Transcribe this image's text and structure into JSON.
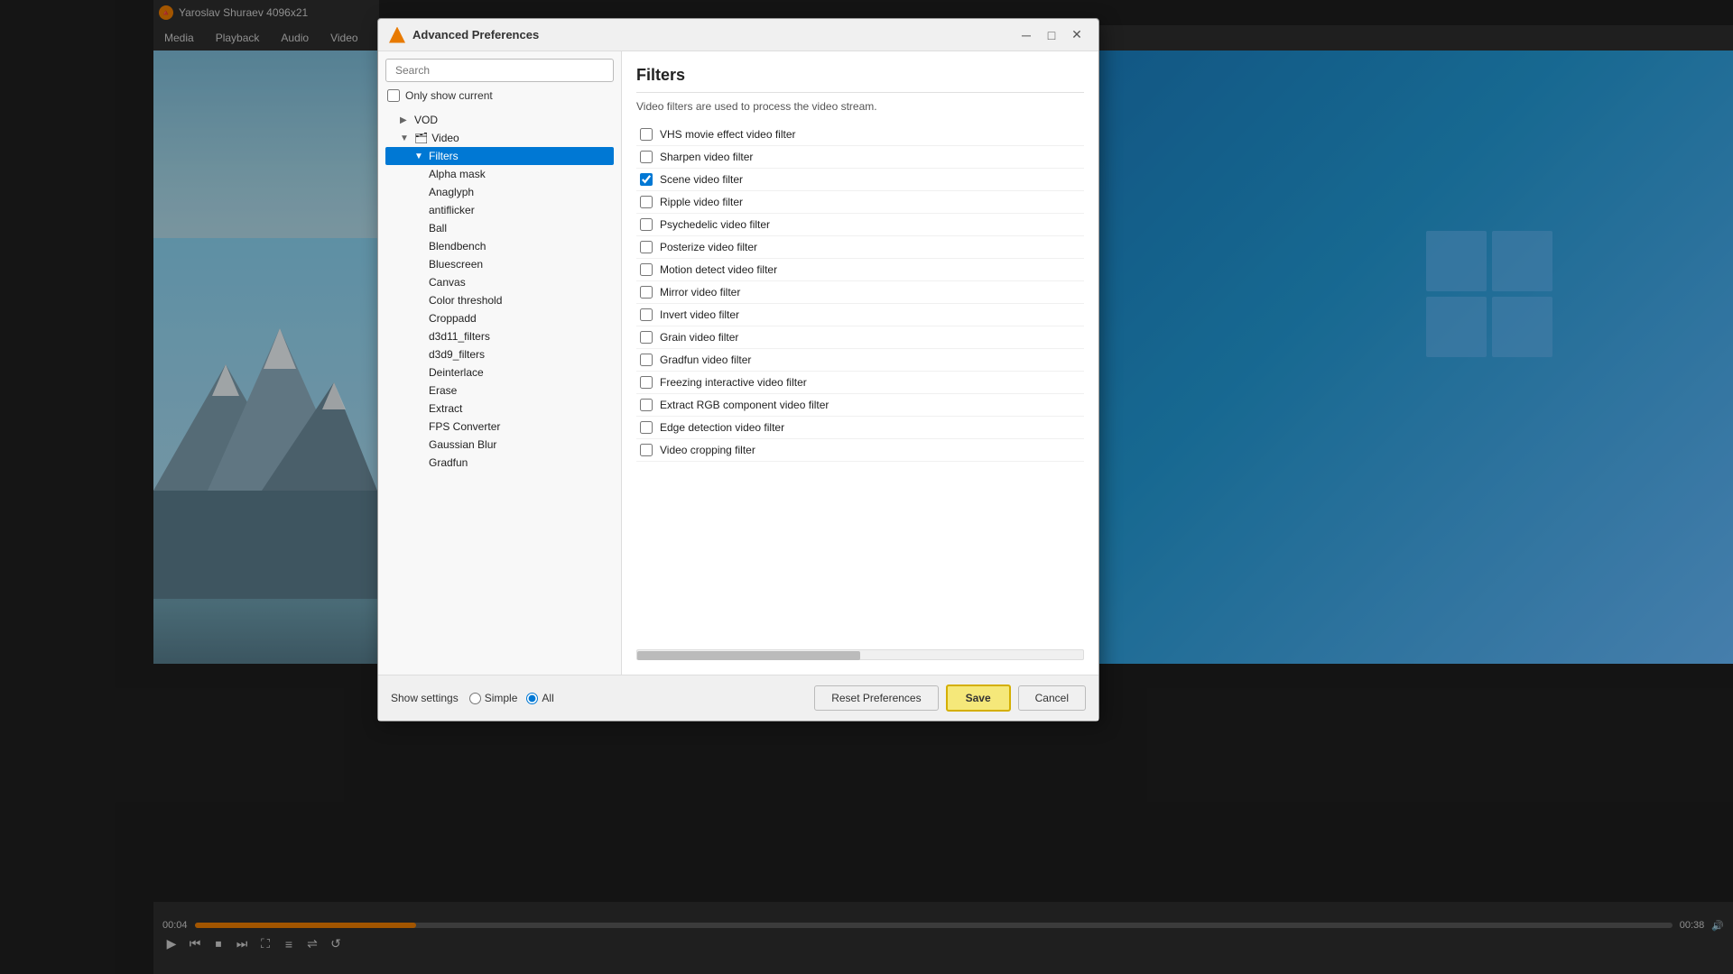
{
  "app": {
    "title": "Yaroslav Shuraev 4096x21",
    "vlc_icon": "▶",
    "menubar": {
      "items": [
        "Media",
        "Playback",
        "Audio",
        "Video"
      ]
    }
  },
  "dialog": {
    "title": "Advanced Preferences",
    "title_icon": "cone",
    "controls": {
      "minimize": "─",
      "maximize": "□",
      "close": "✕"
    }
  },
  "left_panel": {
    "search": {
      "placeholder": "Search",
      "value": ""
    },
    "only_show_current": {
      "label": "Only show current",
      "checked": false
    },
    "tree": {
      "items": [
        {
          "id": "vod",
          "label": "VOD",
          "indent": 1,
          "icon": "▶",
          "expanded": false
        },
        {
          "id": "video",
          "label": "Video",
          "indent": 1,
          "icon": "▼",
          "expanded": true,
          "folder": true
        },
        {
          "id": "filters",
          "label": "Filters",
          "indent": 2,
          "icon": "▼",
          "expanded": true,
          "selected": true
        },
        {
          "id": "alpha-mask",
          "label": "Alpha mask",
          "indent": 3
        },
        {
          "id": "anaglyph",
          "label": "Anaglyph",
          "indent": 3
        },
        {
          "id": "antiflicker",
          "label": "antiflicker",
          "indent": 3
        },
        {
          "id": "ball",
          "label": "Ball",
          "indent": 3
        },
        {
          "id": "blendbench",
          "label": "Blendbench",
          "indent": 3
        },
        {
          "id": "bluescreen",
          "label": "Bluescreen",
          "indent": 3
        },
        {
          "id": "canvas",
          "label": "Canvas",
          "indent": 3
        },
        {
          "id": "color-threshold",
          "label": "Color threshold",
          "indent": 3
        },
        {
          "id": "croppadd",
          "label": "Croppadd",
          "indent": 3
        },
        {
          "id": "d3d11-filters",
          "label": "d3d11_filters",
          "indent": 3
        },
        {
          "id": "d3d9-filters",
          "label": "d3d9_filters",
          "indent": 3
        },
        {
          "id": "deinterlace",
          "label": "Deinterlace",
          "indent": 3
        },
        {
          "id": "erase",
          "label": "Erase",
          "indent": 3
        },
        {
          "id": "extract",
          "label": "Extract",
          "indent": 3
        },
        {
          "id": "fps-converter",
          "label": "FPS Converter",
          "indent": 3
        },
        {
          "id": "gaussian-blur",
          "label": "Gaussian Blur",
          "indent": 3
        },
        {
          "id": "gradfun",
          "label": "Gradfun",
          "indent": 3
        }
      ]
    }
  },
  "right_panel": {
    "title": "Filters",
    "description": "Video filters are used to process the video stream.",
    "filters": [
      {
        "id": "vhs",
        "label": "VHS movie effect video filter",
        "checked": false
      },
      {
        "id": "sharpen",
        "label": "Sharpen video filter",
        "checked": false
      },
      {
        "id": "scene",
        "label": "Scene video filter",
        "checked": true
      },
      {
        "id": "ripple",
        "label": "Ripple video filter",
        "checked": false
      },
      {
        "id": "psychedelic",
        "label": "Psychedelic video filter",
        "checked": false
      },
      {
        "id": "posterize",
        "label": "Posterize video filter",
        "checked": false
      },
      {
        "id": "motion-detect",
        "label": "Motion detect video filter",
        "checked": false
      },
      {
        "id": "mirror",
        "label": "Mirror video filter",
        "checked": false
      },
      {
        "id": "invert",
        "label": "Invert video filter",
        "checked": false
      },
      {
        "id": "grain",
        "label": "Grain video filter",
        "checked": false
      },
      {
        "id": "gradfun",
        "label": "Gradfun video filter",
        "checked": false
      },
      {
        "id": "freezing",
        "label": "Freezing interactive video filter",
        "checked": false
      },
      {
        "id": "extract-rgb",
        "label": "Extract RGB component video filter",
        "checked": false
      },
      {
        "id": "edge-detection",
        "label": "Edge detection video filter",
        "checked": false
      },
      {
        "id": "video-cropping",
        "label": "Video cropping filter",
        "checked": false
      }
    ]
  },
  "bottom_bar": {
    "show_settings_label": "Show settings",
    "simple_label": "Simple",
    "all_label": "All",
    "simple_checked": false,
    "all_checked": true,
    "reset_label": "Reset Preferences",
    "save_label": "Save",
    "cancel_label": "Cancel"
  },
  "vlc_controls": {
    "time_current": "00:04",
    "time_total": "00:38",
    "play_btn": "▶",
    "prev_btn": "⏮",
    "stop_btn": "⏹",
    "next_btn": "⏭",
    "fullscreen_btn": "⛶",
    "extended_btn": "≡",
    "shuffle_btn": "⇌",
    "repeat_btn": "↺",
    "volume_btn": "🔊"
  }
}
